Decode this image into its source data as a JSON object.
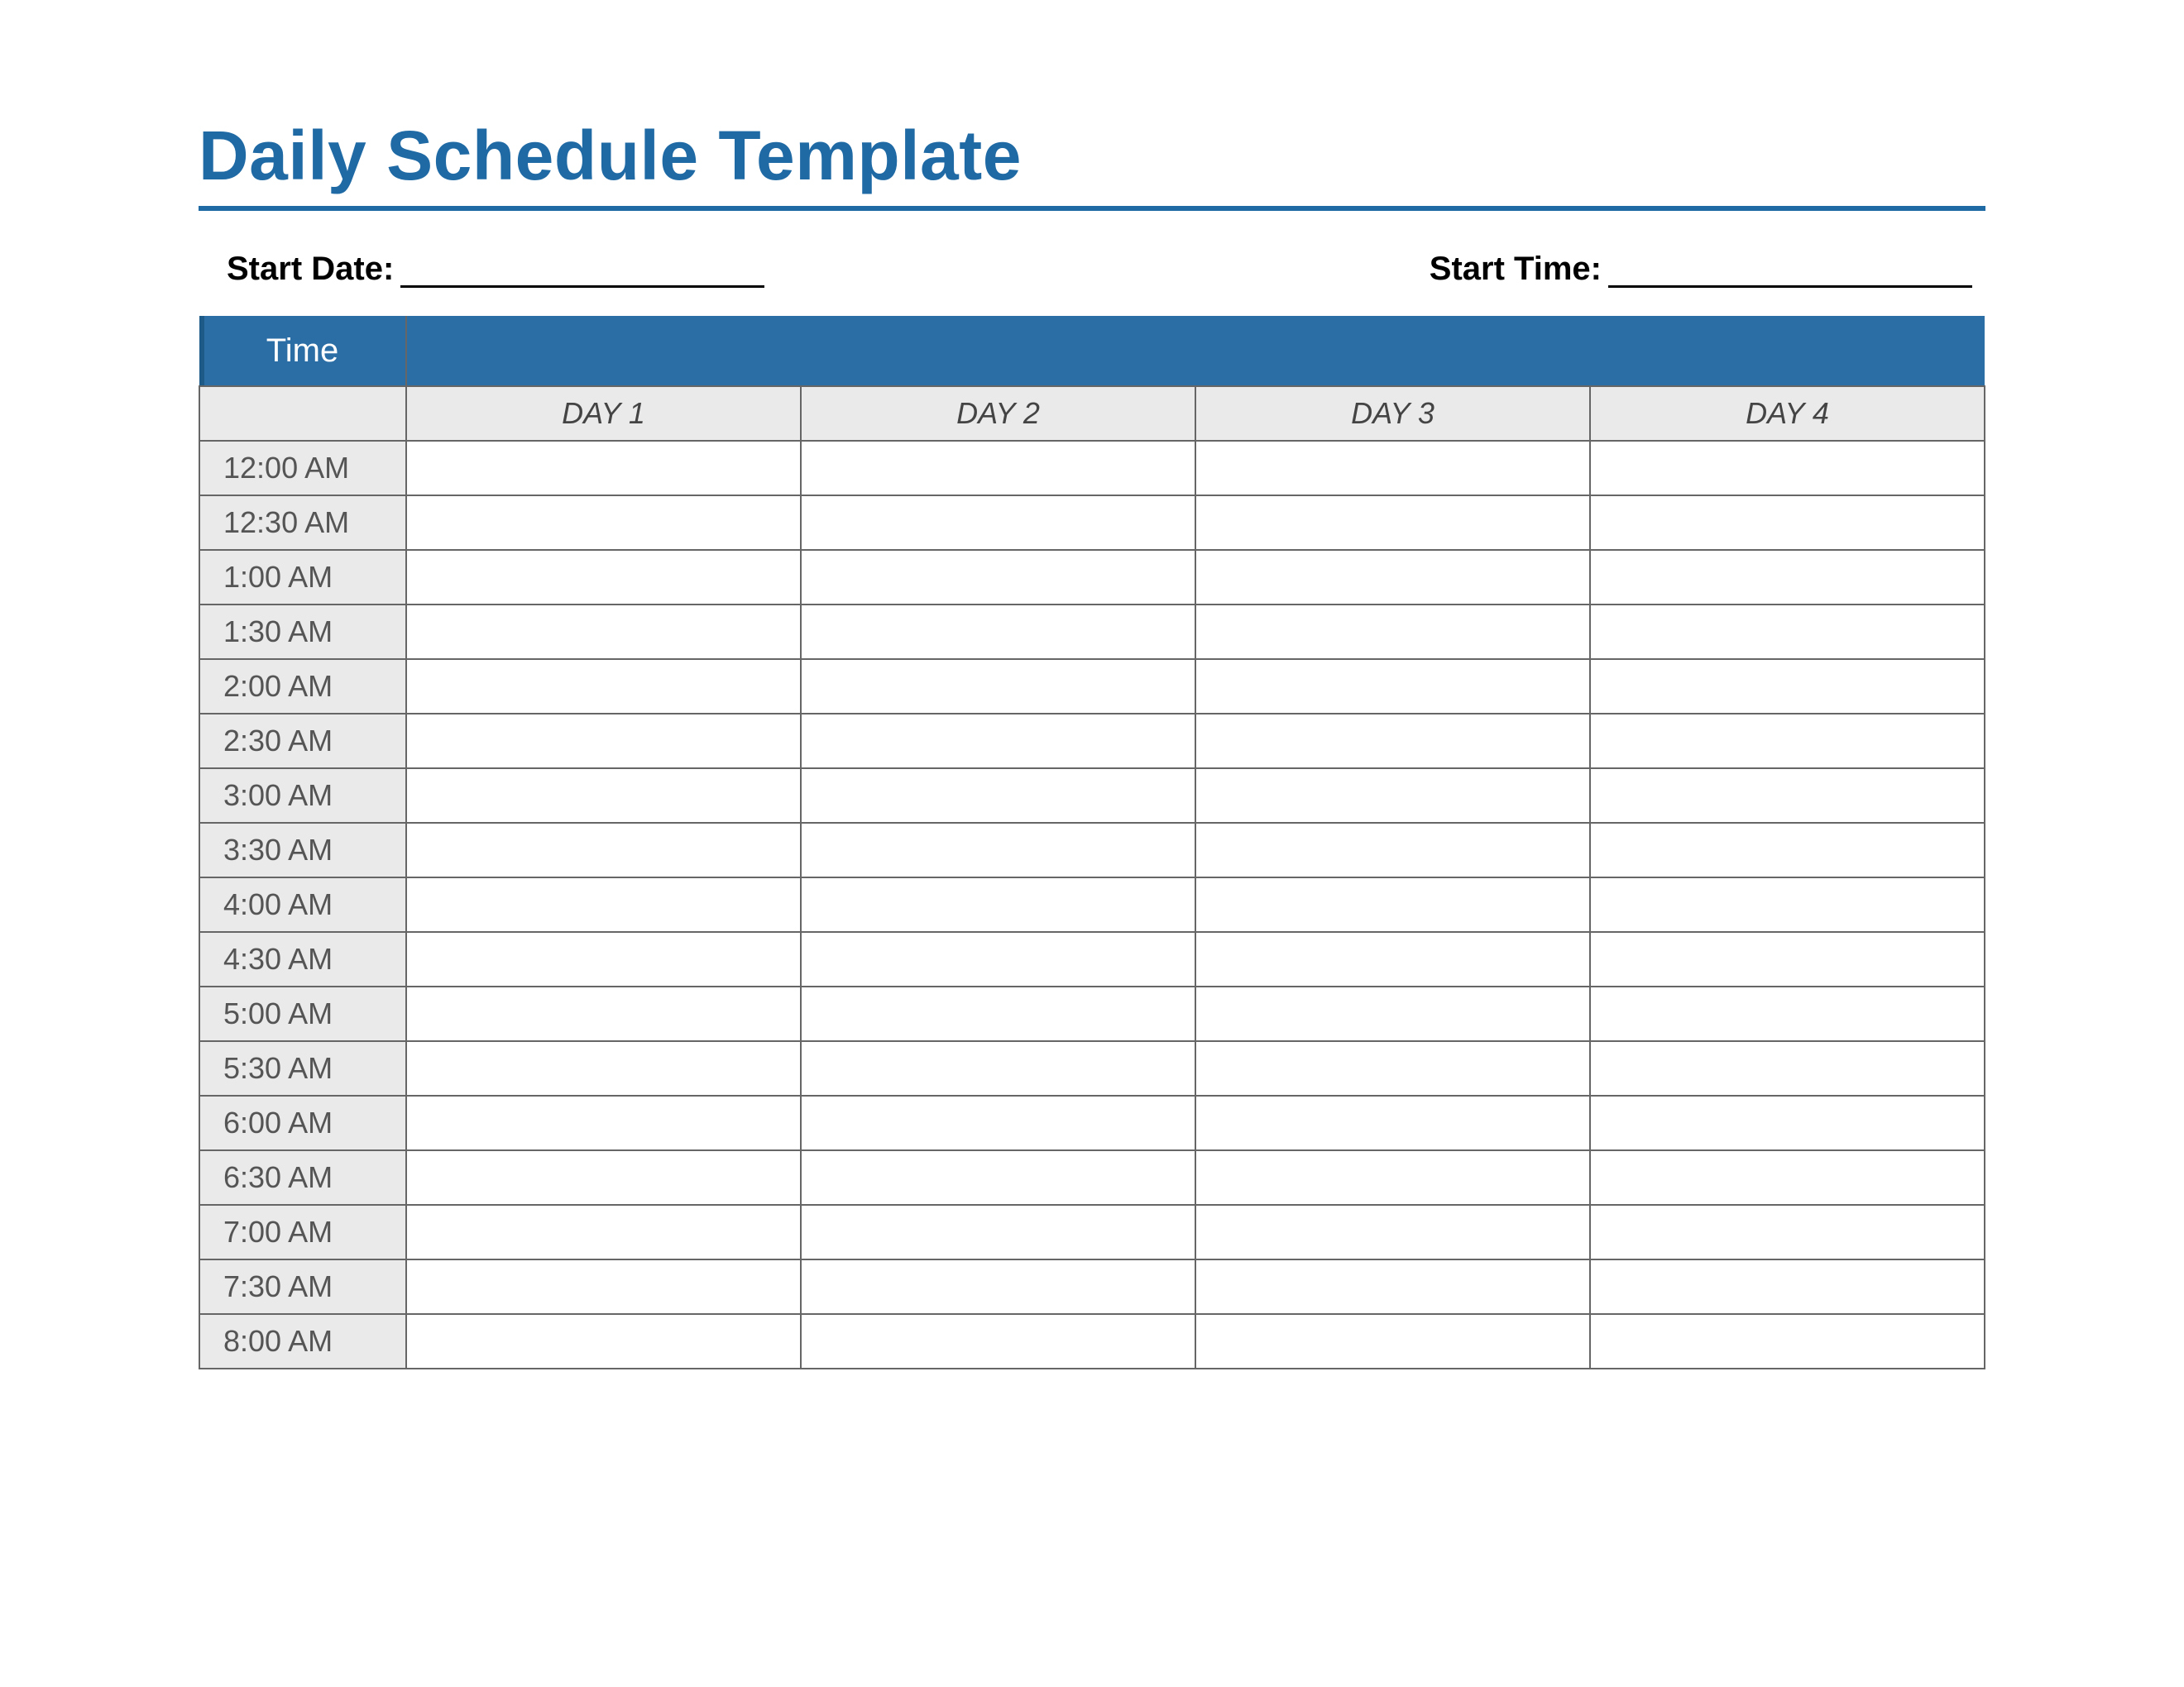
{
  "title": "Daily Schedule Template",
  "meta": {
    "startDateLabel": "Start Date:",
    "startTimeLabel": "Start Time:",
    "startDateValue": "",
    "startTimeValue": ""
  },
  "table": {
    "timeHeader": "Time",
    "days": [
      "DAY 1",
      "DAY 2",
      "DAY 3",
      "DAY 4"
    ],
    "slots": [
      "12:00 AM",
      "12:30 AM",
      "1:00 AM",
      "1:30 AM",
      "2:00 AM",
      "2:30 AM",
      "3:00 AM",
      "3:30 AM",
      "4:00 AM",
      "4:30 AM",
      "5:00 AM",
      "5:30 AM",
      "6:00 AM",
      "6:30 AM",
      "7:00 AM",
      "7:30 AM",
      "8:00 AM"
    ]
  },
  "colors": {
    "brand": "#1f6aa5",
    "headerBar": "#2a6ea5",
    "cellAlt": "#eaeaea",
    "border": "#666666"
  }
}
